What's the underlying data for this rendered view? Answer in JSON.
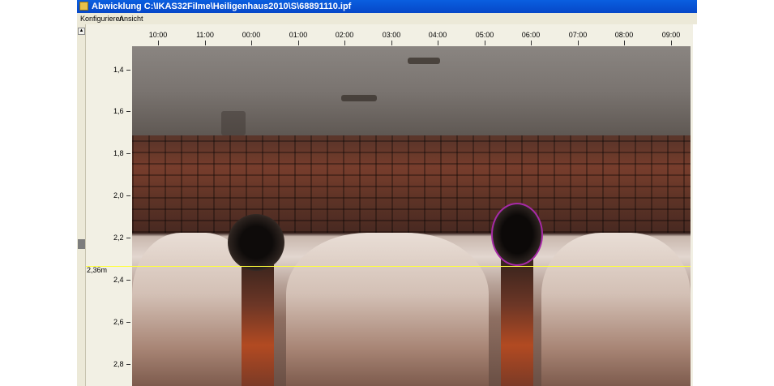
{
  "window": {
    "title": "Abwicklung  C:\\IKAS32Filme\\Heiligenhaus2010\\S\\68891110.ipf"
  },
  "menu": {
    "items": [
      "Konfigurieren",
      "Ansicht"
    ]
  },
  "clock_axis": {
    "labels": [
      "10:00",
      "11:00",
      "00:00",
      "01:00",
      "02:00",
      "03:00",
      "04:00",
      "05:00",
      "06:00",
      "07:00",
      "08:00",
      "09:00"
    ]
  },
  "depth_axis": {
    "labels": [
      "1,4",
      "1,6",
      "1,8",
      "2,0",
      "2,2",
      "2,4",
      "2,6",
      "2,8"
    ]
  },
  "marker": {
    "label": "2,36m",
    "line_color": "#ffff3a"
  },
  "highlight": {
    "shape": "ellipse",
    "color": "#a62aa6"
  },
  "colors": {
    "titlebar": "#0647c8",
    "menubar": "#ece9d8",
    "ruler": "#f2f0e4"
  }
}
